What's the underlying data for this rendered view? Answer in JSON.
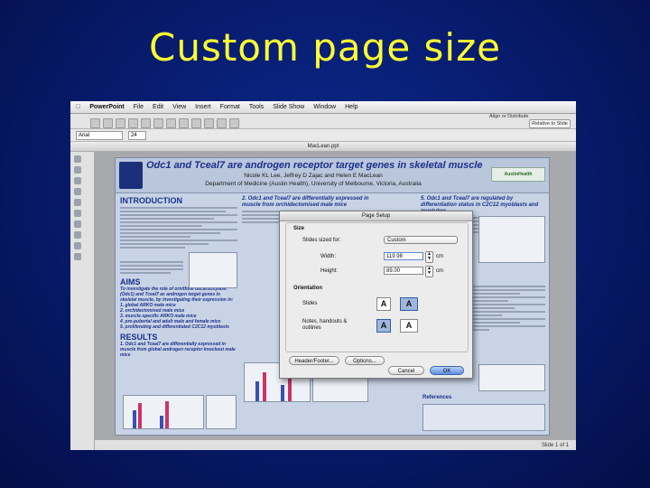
{
  "slide": {
    "title": "Custom page size"
  },
  "menubar": {
    "items": [
      "PowerPoint",
      "File",
      "Edit",
      "View",
      "Insert",
      "Format",
      "Tools",
      "Slide Show",
      "Window",
      "Help"
    ]
  },
  "toolbar": {
    "tab_caption": "Align or Distribute",
    "relative_button": "Relative to Slide"
  },
  "formatting": {
    "font": "Arial",
    "size": "24"
  },
  "document": {
    "title": "MacLean.ppt"
  },
  "statusbar": {
    "text": "Slide 1 of 1"
  },
  "poster": {
    "title": "Odc1 and Tceal7 are androgen receptor target genes in skeletal muscle",
    "authors": "Nicole KL Lee, Jeffrey D Zajac and Helen E MacLean",
    "department": "Department of Medicine (Austin Health), University of Melbourne, Victoria, Australia",
    "sponsor": "AustinHealth",
    "sections": {
      "introduction": "INTRODUCTION",
      "aims": "AIMS",
      "aims_text": "To investigate the role of ornithine decarboxylase (Odc1) and Tceal7 as androgen target genes in skeletal muscle, by investigating their expression in:",
      "aims_items": [
        "1. global ARKO male mice",
        "2. orchidectomised male mice",
        "3. muscle-specific ARKO male mice",
        "4. pre-pubertal and adult male and female mice",
        "5. proliferating and differentiated C2C12 myoblasts"
      ],
      "results": "RESULTS",
      "results_sub": "1. Odc1 and Tceal7 are differentially expressed in muscle from global androgen receptor knockout male mice",
      "col2_sub": "2. Odc1 and Tceal7 are differentially expressed in muscle from orchidectomised male mice",
      "col3_sub": "5. Odc1 and Tceal7 are regulated by differentiation status in C2C12 myoblasts and myotubes",
      "conclusions": "ONS",
      "references": "References"
    }
  },
  "page_setup": {
    "title": "Page Setup",
    "size_label": "Size",
    "slides_sized_for_label": "Slides sized for:",
    "slides_sized_for_value": "Custom",
    "width_label": "Width:",
    "width_value": "119.98",
    "width_unit": "cm",
    "height_label": "Height:",
    "height_value": "89.00",
    "height_unit": "cm",
    "orientation_label": "Orientation",
    "slides_label": "Slides",
    "notes_label": "Notes, handouts & outlines",
    "header_footer_button": "Header/Footer...",
    "options_button": "Options...",
    "cancel_button": "Cancel",
    "ok_button": "OK"
  }
}
